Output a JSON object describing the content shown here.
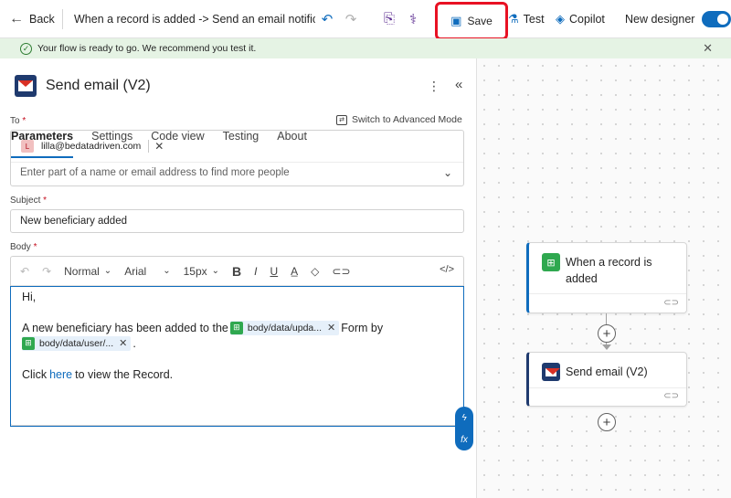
{
  "topbar": {
    "back_label": "Back",
    "flow_title": "When a record is added -> Send an email notificatio",
    "save_label": "Save",
    "test_label": "Test",
    "copilot_label": "Copilot",
    "new_designer_label": "New designer",
    "new_designer_on": true
  },
  "banner": {
    "message": "Your flow is ready to go. We recommend you test it."
  },
  "panel": {
    "title": "Send email (V2)",
    "tabs": [
      {
        "label": "Parameters",
        "active": true
      },
      {
        "label": "Settings"
      },
      {
        "label": "Code view"
      },
      {
        "label": "Testing"
      },
      {
        "label": "About"
      }
    ],
    "to_label": "To",
    "advanced_mode_label": "Switch to Advanced Mode",
    "to_chip": {
      "initial": "L",
      "email": "lilla@bedatadriven.com"
    },
    "to_placeholder": "Enter part of a name or email address to find more people",
    "subject_label": "Subject",
    "subject_value": "New beneficiary added",
    "body_label": "Body",
    "toolbar": {
      "style": "Normal",
      "font": "Arial",
      "size": "15px",
      "bold": "B",
      "italic": "I",
      "underline": "U"
    },
    "body": {
      "greeting": "Hi,",
      "line2_prefix": "A new beneficiary has been added to the",
      "token1": "body/data/upda...",
      "line2_suffix": "Form by",
      "token2": "body/data/user/...",
      "period": ".",
      "line3_prefix": "Click",
      "link": "here",
      "line3_suffix": "to view the Record."
    }
  },
  "canvas": {
    "trigger_title": "When a record is added",
    "action_title": "Send email (V2)"
  },
  "colors": {
    "accent": "#0f6cbd",
    "save_highlight": "#e81123",
    "banner_bg": "#e5f3e4",
    "dataverse_green": "#2fa84f"
  }
}
